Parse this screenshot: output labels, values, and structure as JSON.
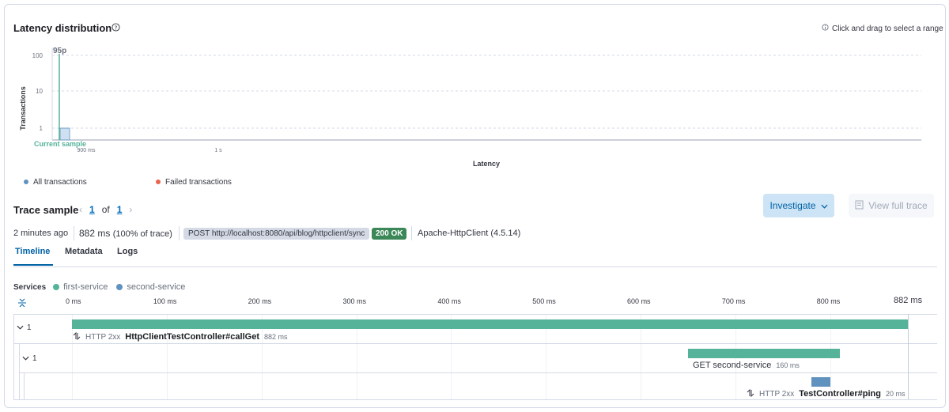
{
  "latency": {
    "title": "Latency distribution",
    "hint": "Click and drag to select a range",
    "percentile_label": "95p",
    "current_sample_label": "Current sample",
    "legend": [
      {
        "label": "All transactions",
        "color": "#6092c0"
      },
      {
        "label": "Failed transactions",
        "color": "#e7664c"
      }
    ]
  },
  "chart_data": {
    "type": "bar",
    "title": "",
    "xlabel": "Latency",
    "ylabel": "Transactions",
    "y_scale": "log",
    "y_ticks": [
      "100",
      "10",
      "1"
    ],
    "x_ticks": [
      "900 ms",
      "1 s"
    ],
    "bars": [
      {
        "x_ms": 882,
        "count": 1
      }
    ],
    "percentile_95_ms": 882,
    "grid": true
  },
  "trace": {
    "title": "Trace sample",
    "page_current": "1",
    "page_of": "of",
    "page_total": "1",
    "investigate_label": "Investigate",
    "view_full_label": "View full trace",
    "time_ago": "2 minutes ago",
    "duration": "882 ms",
    "duration_pct": "(100% of trace)",
    "request": "POST http://localhost:8080/api/blog/httpclient/sync",
    "status": "200 OK",
    "user_agent": "Apache-HttpClient (4.5.14)"
  },
  "tabs": [
    {
      "label": "Timeline",
      "active": true
    },
    {
      "label": "Metadata",
      "active": false
    },
    {
      "label": "Logs",
      "active": false
    }
  ],
  "services": {
    "label": "Services",
    "items": [
      {
        "name": "first-service",
        "color": "#54b399"
      },
      {
        "name": "second-service",
        "color": "#6092c0"
      }
    ]
  },
  "timeline": {
    "ticks": [
      "0 ms",
      "100 ms",
      "200 ms",
      "300 ms",
      "400 ms",
      "500 ms",
      "600 ms",
      "700 ms",
      "800 ms"
    ],
    "end_label": "882 ms",
    "total_ms": 882,
    "spans": [
      {
        "count": "1",
        "kind": "HTTP 2xx",
        "name": "HttpClientTestController#callGet",
        "duration": "882 ms",
        "start_ms": 0,
        "dur_ms": 882,
        "color": "#54b399"
      },
      {
        "count": "1",
        "name": "GET second-service",
        "duration": "160 ms",
        "start_ms": 650,
        "dur_ms": 160,
        "color": "#54b399"
      },
      {
        "kind": "HTTP 2xx",
        "name": "TestController#ping",
        "duration": "20 ms",
        "start_ms": 780,
        "dur_ms": 20,
        "color": "#6092c0"
      }
    ]
  }
}
